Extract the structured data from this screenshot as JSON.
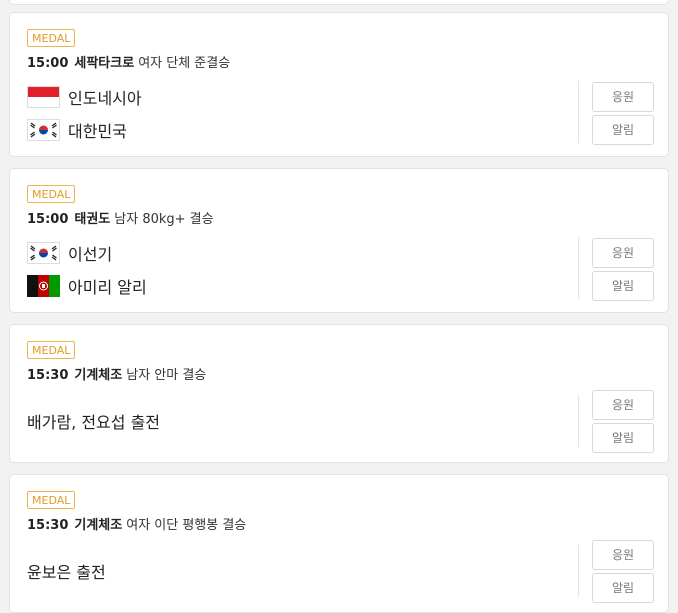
{
  "colors": {
    "medal_border": "#f0b350",
    "medal_text": "#e39c28"
  },
  "buttons": {
    "cheer": "응원",
    "alarm": "알림"
  },
  "cards": [
    {
      "badge": "MEDAL",
      "time": "15:00",
      "sport": "세팍타크로",
      "event": "여자 단체 준결승",
      "team1": {
        "name": "인도네시아",
        "flag": "indonesia-flag-icon"
      },
      "team2": {
        "name": "대한민국",
        "flag": "korea-flag-icon"
      }
    },
    {
      "badge": "MEDAL",
      "time": "15:00",
      "sport": "태권도",
      "event": "남자 80kg+ 결승",
      "team1": {
        "name": "이선기",
        "flag": "korea-flag-icon"
      },
      "team2": {
        "name": "아미리 알리",
        "flag": "afghanistan-flag-icon"
      }
    },
    {
      "badge": "MEDAL",
      "time": "15:30",
      "sport": "기계체조",
      "event": "남자 안마 결승",
      "text": "배가람, 전요섭 출전"
    },
    {
      "badge": "MEDAL",
      "time": "15:30",
      "sport": "기계체조",
      "event": "여자 이단 평행봉 결승",
      "text": "윤보은 출전"
    }
  ]
}
